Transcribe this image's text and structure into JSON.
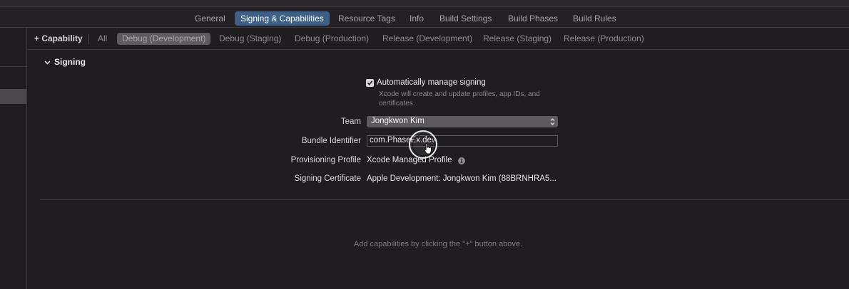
{
  "tabs": [
    {
      "label": "General"
    },
    {
      "label": "Signing & Capabilities"
    },
    {
      "label": "Resource Tags"
    },
    {
      "label": "Info"
    },
    {
      "label": "Build Settings"
    },
    {
      "label": "Build Phases"
    },
    {
      "label": "Build Rules"
    }
  ],
  "config_bar": {
    "add_capability": "+ Capability",
    "items": [
      {
        "label": "All"
      },
      {
        "label": "Debug (Development)"
      },
      {
        "label": "Debug (Staging)"
      },
      {
        "label": "Debug (Production)"
      },
      {
        "label": "Release (Development)"
      },
      {
        "label": "Release (Staging)"
      },
      {
        "label": "Release (Production)"
      }
    ],
    "selected": "Debug (Development)"
  },
  "signing": {
    "section_title": "Signing",
    "auto_manage_label": "Automatically manage signing",
    "auto_manage_checked": true,
    "auto_manage_desc": "Xcode will create and update profiles, app IDs, and certificates.",
    "team_label": "Team",
    "team_value": "Jongkwon Kim",
    "bundle_label": "Bundle Identifier",
    "bundle_value": "com.PhaseEx.dev",
    "profile_label": "Provisioning Profile",
    "profile_value": "Xcode Managed Profile",
    "cert_label": "Signing Certificate",
    "cert_value": "Apple Development: Jongkwon Kim (88BRNHRA5..."
  },
  "capabilities_hint": "Add capabilities by clicking the \"+\" button above.",
  "icons": {
    "chevron": "chevron-down-icon",
    "checkbox": "checkmark-icon",
    "updown": "updown-arrows-icon",
    "info": "info-icon",
    "cursor": "pointer-cursor-icon"
  },
  "colors": {
    "accent": "#3e5f86",
    "background": "#1f1d20",
    "selected_config": "#5d5b5e"
  }
}
